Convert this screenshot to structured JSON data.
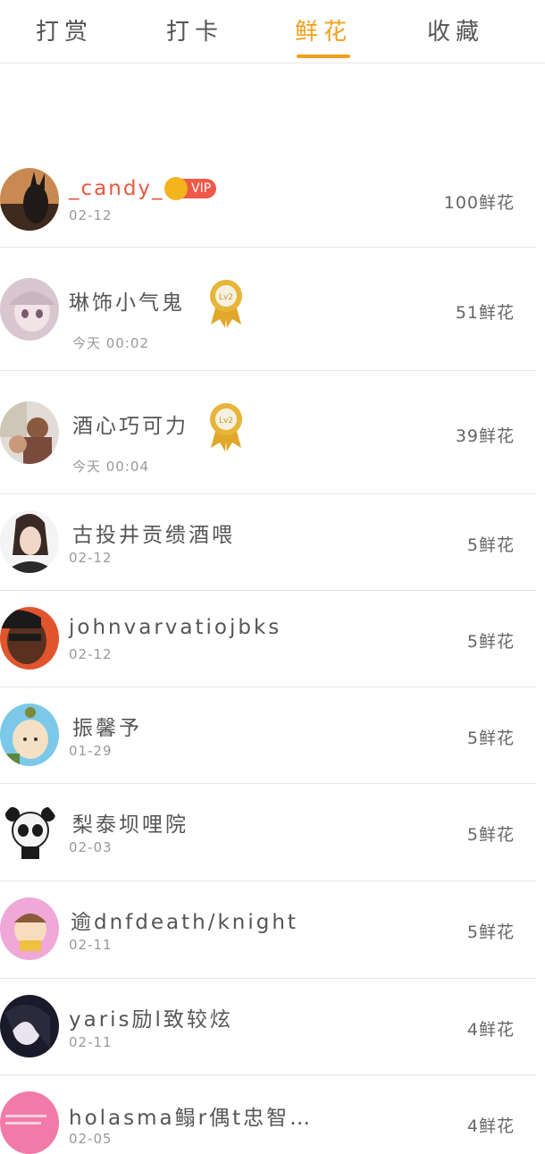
{
  "tabs": [
    {
      "label": "打赏",
      "active": false
    },
    {
      "label": "打卡",
      "active": false
    },
    {
      "label": "鲜花",
      "active": true
    },
    {
      "label": "收藏",
      "active": false
    }
  ],
  "accent_color": "#f0a01c",
  "list": [
    {
      "name": "_candy_",
      "badge": "VIP",
      "date": "02-12",
      "amount": "100鲜花"
    },
    {
      "name": "琳饰小气鬼",
      "badge": "Lv2",
      "date": "今天 00:02",
      "amount": "51鲜花"
    },
    {
      "name": "酒心巧可力",
      "badge": "Lv2",
      "date": "今天 00:04",
      "amount": "39鲜花"
    },
    {
      "name": "古投井贡缋酒喂",
      "date": "02-12",
      "amount": "5鲜花"
    },
    {
      "name": "johnvarvatiojbks",
      "date": "02-12",
      "amount": "5鲜花"
    },
    {
      "name": "振馨予",
      "date": "01-29",
      "amount": "5鲜花"
    },
    {
      "name": "梨泰坝哩院",
      "date": "02-03",
      "amount": "5鲜花"
    },
    {
      "name": "逾dnfdeath/knight",
      "date": "02-11",
      "amount": "5鲜花"
    },
    {
      "name": "yaris励l致较炫",
      "date": "02-11",
      "amount": "4鲜花"
    },
    {
      "name": "holasma鳎r偶t忠智…",
      "date": "02-05",
      "amount": "4鲜花"
    }
  ]
}
